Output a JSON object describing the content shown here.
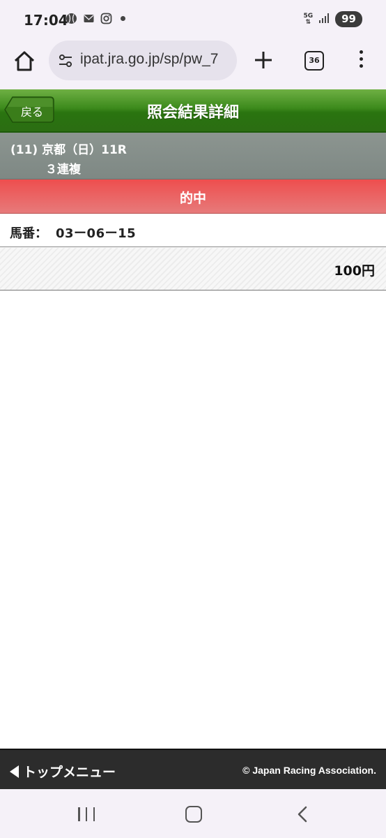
{
  "status_bar": {
    "time": "17:04",
    "icons": [
      "baseball-icon",
      "mail-icon",
      "instagram-icon",
      "dot-icon"
    ],
    "network": "5G",
    "battery": "99"
  },
  "browser": {
    "url": "ipat.jra.go.jp/sp/pw_7",
    "tab_count": "36"
  },
  "header": {
    "back_label": "戻る",
    "title": "照会結果詳細",
    "color": "#3c8a1c"
  },
  "race": {
    "line1": "(11) 京都（日）11R",
    "line2": "３連複"
  },
  "result": {
    "status": "的中",
    "color": "#ee4e4e"
  },
  "horse": {
    "label": "馬番：",
    "value": "03ー06ー15"
  },
  "amount": "100円",
  "footer": {
    "menu_label": "トップメニュー",
    "copyright": "© Japan Racing Association."
  }
}
